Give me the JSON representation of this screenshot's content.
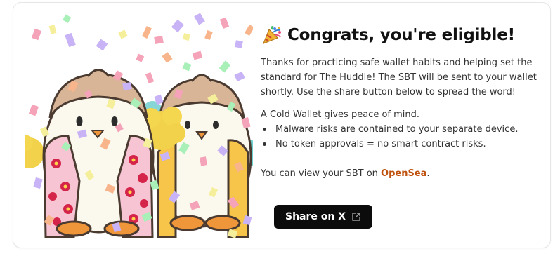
{
  "card": {
    "title": "Congrats, you're eligible!",
    "title_icon": "party-popper-icon",
    "intro": "Thanks for practicing safe wallet habits and helping set the standard for The Huddle! The SBT will be sent to your wallet shortly. Use the share button below to spread the word!",
    "cold_wallet_heading": "A Cold Wallet gives peace of mind.",
    "bullets": [
      "Malware risks are contained to your separate device.",
      "No token approvals = no smart contract risks."
    ],
    "view_prefix": "You can view your SBT on ",
    "view_link": "OpenSea",
    "view_suffix": ".",
    "share_label": "Share on X",
    "share_icon": "external-link-icon"
  },
  "illustration": {
    "subject": "penguins-confetti-illustration",
    "colors": {
      "link": "#c0520f",
      "button_bg": "#0c0c0c"
    }
  }
}
